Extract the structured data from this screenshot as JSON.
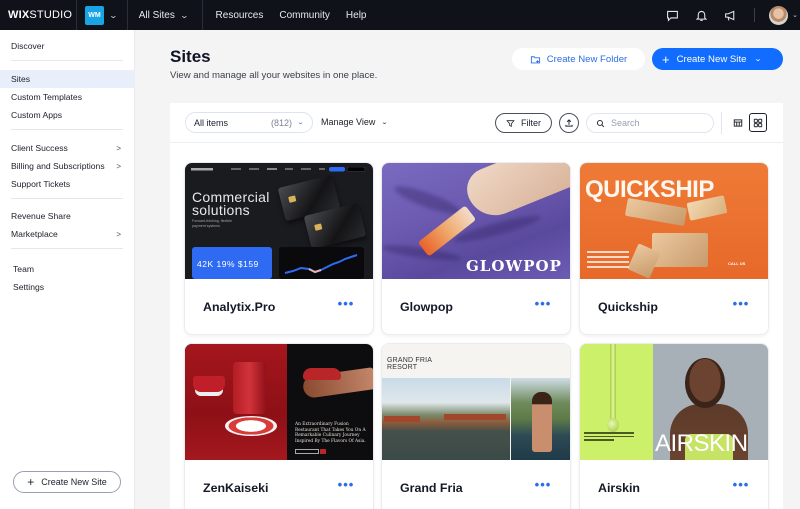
{
  "topbar": {
    "logo_bold": "WIX",
    "logo_light": "STUDIO",
    "workspace_badge": "WM",
    "sites_selector": "All Sites",
    "nav": [
      "Resources",
      "Community",
      "Help"
    ],
    "icons": [
      "chat-icon",
      "bell-icon",
      "megaphone-icon"
    ]
  },
  "sidebar": {
    "items": [
      {
        "label": "Discover",
        "arrow": false
      },
      {
        "label": "Sites",
        "arrow": false,
        "active": true
      },
      {
        "label": "Custom Templates",
        "arrow": false
      },
      {
        "label": "Custom Apps",
        "arrow": false
      },
      {
        "label": "Client Success",
        "arrow": true
      },
      {
        "label": "Billing and Subscriptions",
        "arrow": true
      },
      {
        "label": "Support Tickets",
        "arrow": false
      },
      {
        "label": "Revenue Share",
        "arrow": false
      },
      {
        "label": "Marketplace",
        "arrow": true
      },
      {
        "label": "Team",
        "arrow": false
      },
      {
        "label": "Settings",
        "arrow": false
      }
    ],
    "arrow_glyph": ">",
    "create_button": "Create New Site"
  },
  "header": {
    "title": "Sites",
    "subtitle": "View and manage all your websites in one place.",
    "create_folder": "Create New Folder",
    "create_site": "Create New Site"
  },
  "toolbar": {
    "filter_selector": "All items",
    "filter_count": "(812)",
    "manage_view": "Manage View",
    "filter_button": "Filter",
    "search_placeholder": "Search",
    "search_value": ""
  },
  "sites": [
    {
      "name": "Analytix.Pro",
      "thumb_heading": "Commercial solutions",
      "thumb_sub": "Forward-thinking, flexible payment systems",
      "thumb_stats": "42K  19%  $159"
    },
    {
      "name": "Glowpop",
      "thumb_word": "GLOWPOP"
    },
    {
      "name": "Quickship",
      "thumb_word": "QUICKSHIP",
      "thumb_cta": "CALL US"
    },
    {
      "name": "ZenKaiseki",
      "thumb_text": "An Extraordinary Fusion Restaurant That Takes You On A Remarkable Culinary Journey Inspired By The Flavors Of Asia."
    },
    {
      "name": "Grand Fria",
      "thumb_title_1": "GRAND FRIA",
      "thumb_title_2": "RESORT"
    },
    {
      "name": "Airskin",
      "thumb_word": "AIRSKIN"
    }
  ],
  "more_glyph": "•••",
  "colors": {
    "accent": "#116dff",
    "topbar": "#0f1219",
    "workspace_badge": "#19a4e6",
    "sidebar_active": "#e8eefa"
  }
}
